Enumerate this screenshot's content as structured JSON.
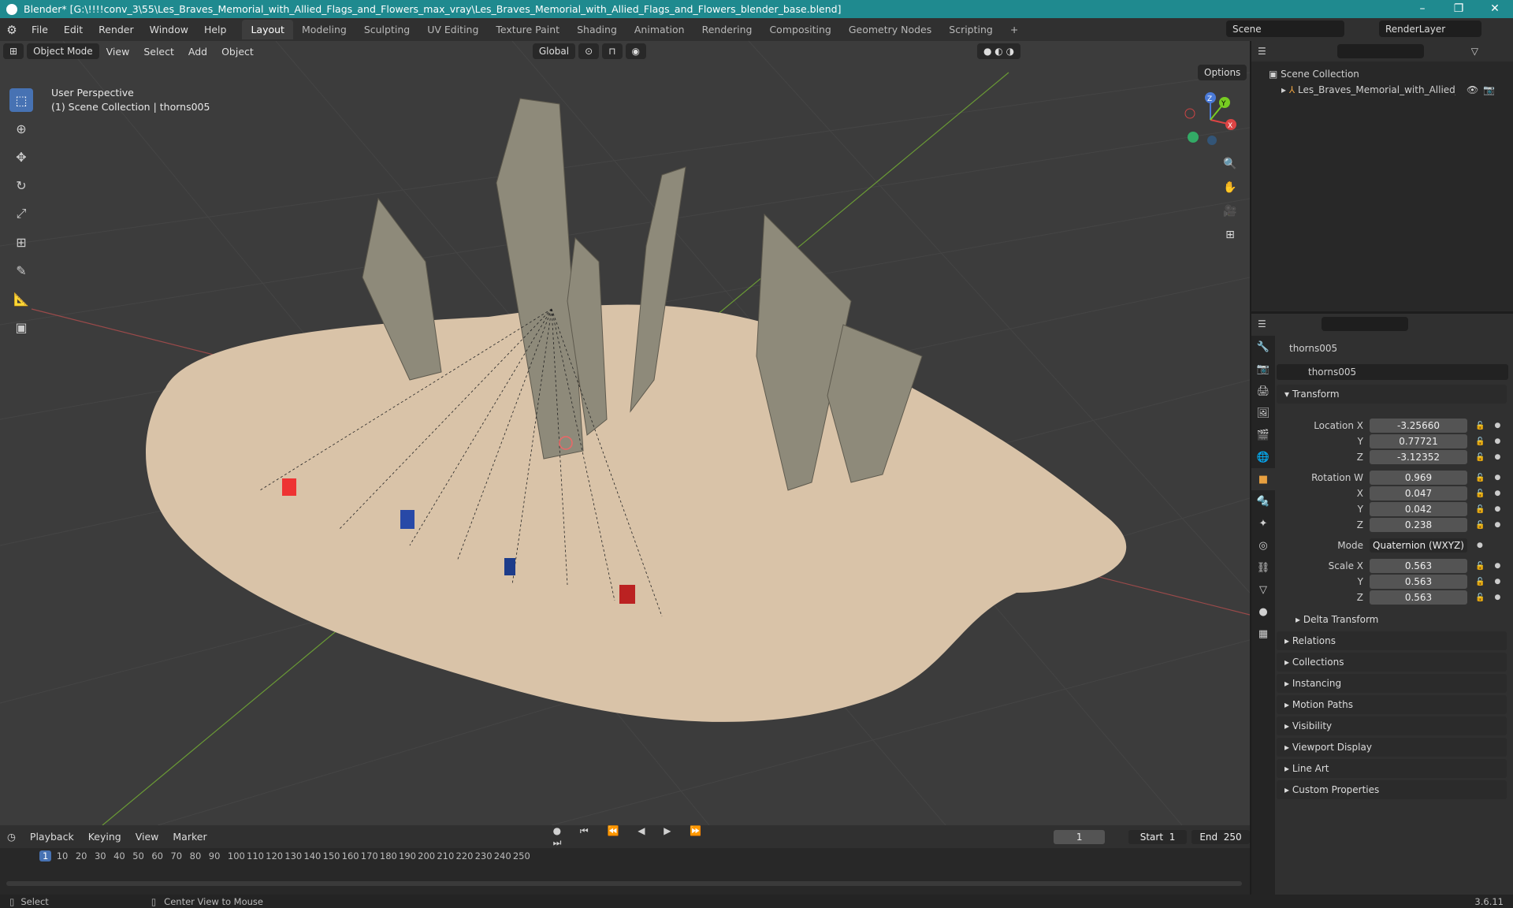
{
  "title": "Blender* [G:\\!!!!conv_3\\55\\Les_Braves_Memorial_with_Allied_Flags_and_Flowers_max_vray\\Les_Braves_Memorial_with_Allied_Flags_and_Flowers_blender_base.blend]",
  "menu": [
    "File",
    "Edit",
    "Render",
    "Window",
    "Help"
  ],
  "workspaces": [
    "Layout",
    "Modeling",
    "Sculpting",
    "UV Editing",
    "Texture Paint",
    "Shading",
    "Animation",
    "Rendering",
    "Compositing",
    "Geometry Nodes",
    "Scripting"
  ],
  "scene": "Scene",
  "renderlayer": "RenderLayer",
  "vp": {
    "mode": "Object Mode",
    "menus": [
      "View",
      "Select",
      "Add",
      "Object"
    ],
    "orient": "Global",
    "options": "Options",
    "persp": "User Perspective",
    "coll": "(1) Scene Collection | thorns005"
  },
  "outliner": {
    "root": "Scene Collection",
    "item": "Les_Braves_Memorial_with_Allied_Flags"
  },
  "props": {
    "obj": "thorns005",
    "data": "thorns005",
    "transform": "Transform",
    "loc": {
      "label": "Location X",
      "x": "-3.25660",
      "y": "0.77721",
      "z": "-3.12352"
    },
    "rot": {
      "label": "Rotation W",
      "w": "0.969",
      "x": "0.047",
      "y": "0.042",
      "z": "0.238"
    },
    "mode_label": "Mode",
    "mode": "Quaternion (WXYZ)",
    "scale": {
      "label": "Scale X",
      "x": "0.563",
      "y": "0.563",
      "z": "0.563"
    },
    "axis": {
      "y": "Y",
      "z": "Z",
      "x": "X"
    },
    "delta": "Delta Transform",
    "sections": [
      "Relations",
      "Collections",
      "Instancing",
      "Motion Paths",
      "Visibility",
      "Viewport Display",
      "Line Art",
      "Custom Properties"
    ]
  },
  "timeline": {
    "menus": [
      "Playback",
      "Keying",
      "View",
      "Marker"
    ],
    "frame": "1",
    "start_label": "Start",
    "start": "1",
    "end_label": "End",
    "end": "250",
    "ticks": [
      "1",
      "10",
      "20",
      "30",
      "40",
      "50",
      "60",
      "70",
      "80",
      "90",
      "100",
      "110",
      "120",
      "130",
      "140",
      "150",
      "160",
      "170",
      "180",
      "190",
      "200",
      "210",
      "220",
      "230",
      "240",
      "250"
    ]
  },
  "status": {
    "select": "Select",
    "center": "Center View to Mouse",
    "version": "3.6.11"
  }
}
